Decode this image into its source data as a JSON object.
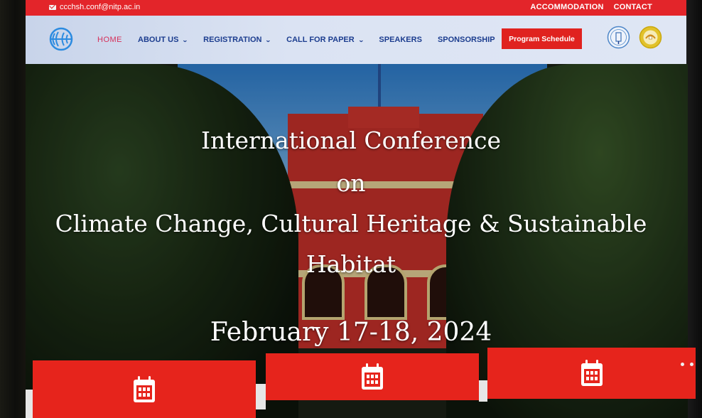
{
  "topbar": {
    "email": "ccchsh.conf@nitp.ac.in",
    "links": [
      "ACCOMMODATION",
      "CONTACT"
    ]
  },
  "nav": {
    "items": [
      {
        "label": "HOME",
        "active": true,
        "dropdown": false
      },
      {
        "label": "ABOUT US",
        "active": false,
        "dropdown": true
      },
      {
        "label": "REGISTRATION",
        "active": false,
        "dropdown": true
      },
      {
        "label": "CALL FOR PAPER",
        "active": false,
        "dropdown": true
      },
      {
        "label": "SPEAKERS",
        "active": false,
        "dropdown": false
      },
      {
        "label": "SPONSORSHIP",
        "active": false,
        "dropdown": false
      }
    ],
    "chevron": "⌄",
    "program_button": "Program Schedule"
  },
  "hero": {
    "line1": "International Conference",
    "line2": "on",
    "line3": "Climate Change, Cultural Heritage & Sustainable",
    "line4": "Habitat",
    "date": "February 17-18, 2024"
  },
  "cards": [
    {
      "icon": "calendar-icon"
    },
    {
      "icon": "calendar-icon"
    },
    {
      "icon": "calendar-icon"
    }
  ],
  "slider": {
    "dots": 2
  },
  "colors": {
    "brand_red": "#e3252a",
    "nav_blue": "#1c3d8f",
    "active_pink": "#d6305a"
  }
}
